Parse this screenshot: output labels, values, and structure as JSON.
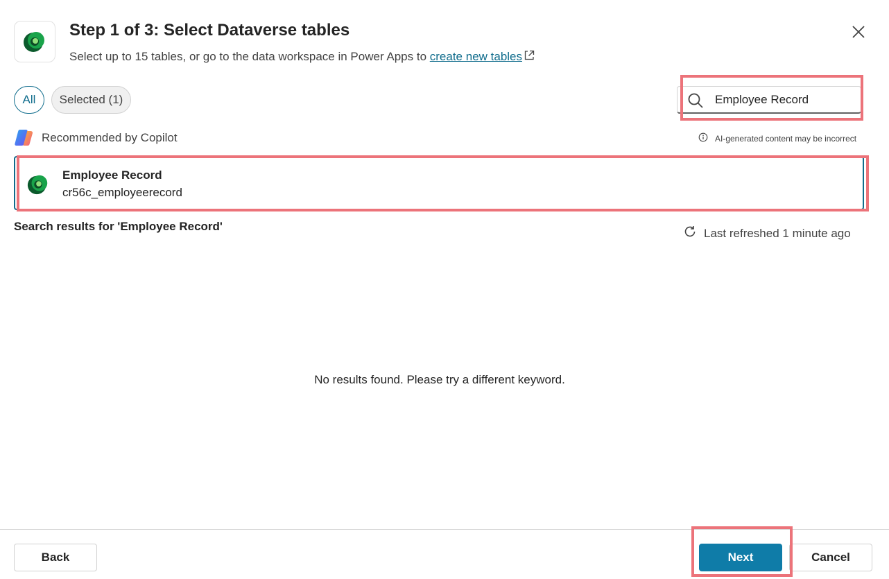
{
  "header": {
    "title": "Step 1 of 3: Select Dataverse tables",
    "subtitle_prefix": "Select up to 15 tables, or go to the data workspace in Power Apps to ",
    "subtitle_link": "create new tables",
    "app_icon": "dataverse-icon",
    "close_icon": "close-icon"
  },
  "filters": {
    "all_label": "All",
    "selected_label": "Selected (1)"
  },
  "search": {
    "value": "Employee Record",
    "placeholder": "Search"
  },
  "copilot": {
    "label": "Recommended by Copilot",
    "ai_note": "AI-generated content may be incorrect"
  },
  "recommended": [
    {
      "title": "Employee Record",
      "subtitle": "cr56c_employeerecord",
      "icon": "dataverse-table-icon"
    }
  ],
  "results": {
    "heading": "Search results for 'Employee Record'",
    "refresh_text": "Last refreshed 1 minute ago",
    "empty_message": "No results found. Please try a different keyword."
  },
  "footer": {
    "back_label": "Back",
    "next_label": "Next",
    "cancel_label": "Cancel"
  },
  "colors": {
    "accent": "#0f6c8c",
    "primary_button": "#0f7ca8",
    "highlight": "#ec737a"
  }
}
